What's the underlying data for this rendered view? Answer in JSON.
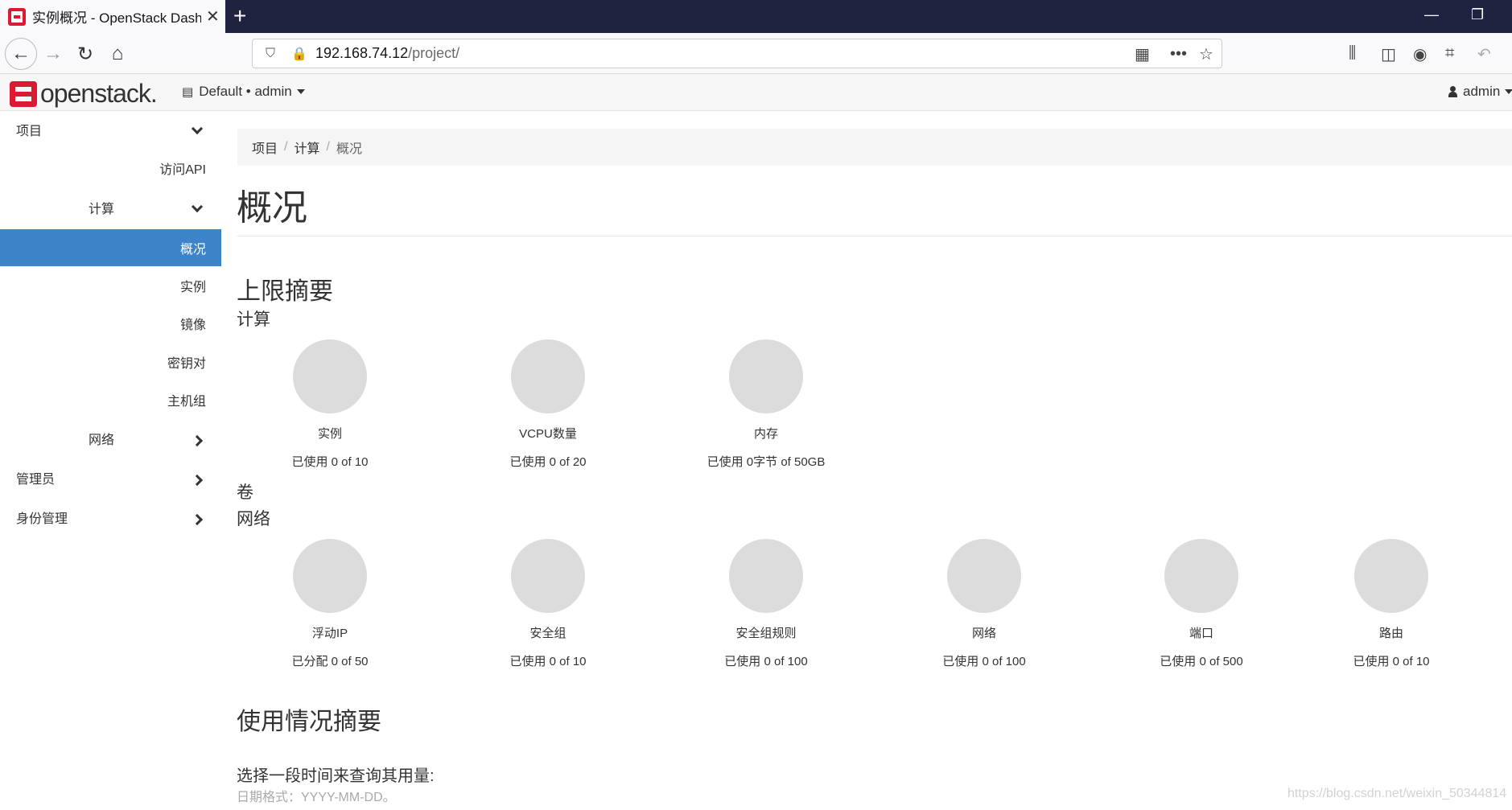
{
  "browser": {
    "tab_title": "实例概况 - OpenStack Dashboard",
    "url_host": "192.168.74.12",
    "url_path": "/project/"
  },
  "header": {
    "logo_text": "openstack.",
    "project_switch": "Default • admin",
    "user": "admin"
  },
  "sidebar": {
    "items": [
      {
        "label": "项目",
        "level": 0,
        "chevron": "down"
      },
      {
        "label": "访问API",
        "level": 2
      },
      {
        "label": "计算",
        "level": 1,
        "chevron": "down"
      },
      {
        "label": "概况",
        "level": 2,
        "active": true
      },
      {
        "label": "实例",
        "level": 2
      },
      {
        "label": "镜像",
        "level": 2
      },
      {
        "label": "密钥对",
        "level": 2
      },
      {
        "label": "主机组",
        "level": 2
      },
      {
        "label": "网络",
        "level": 1,
        "chevron": "right"
      },
      {
        "label": "管理员",
        "level": 0,
        "chevron": "right"
      },
      {
        "label": "身份管理",
        "level": 0,
        "chevron": "right"
      }
    ]
  },
  "breadcrumb": [
    "项目",
    "计算",
    "概况"
  ],
  "page_title": "概况",
  "limits": {
    "heading": "上限摘要",
    "compute": {
      "heading": "计算",
      "charts": [
        {
          "label": "实例",
          "usage": "已使用 0 of 10"
        },
        {
          "label": "VCPU数量",
          "usage": "已使用 0 of 20"
        },
        {
          "label": "内存",
          "usage": "已使用 0字节 of 50GB"
        }
      ]
    },
    "volume_heading": "卷",
    "network": {
      "heading": "网络",
      "charts": [
        {
          "label": "浮动IP",
          "usage": "已分配 0 of 50"
        },
        {
          "label": "安全组",
          "usage": "已使用 0 of 10"
        },
        {
          "label": "安全组规则",
          "usage": "已使用 0 of 100"
        },
        {
          "label": "网络",
          "usage": "已使用 0 of 100"
        },
        {
          "label": "端口",
          "usage": "已使用 0 of 500"
        },
        {
          "label": "路由",
          "usage": "已使用 0 of 10"
        }
      ]
    }
  },
  "usage": {
    "heading": "使用情况摘要",
    "prompt": "选择一段时间来查询其用量:",
    "date_hint": "日期格式：YYYY-MM-DD。"
  },
  "watermark": "https://blog.csdn.net/weixin_50344814"
}
